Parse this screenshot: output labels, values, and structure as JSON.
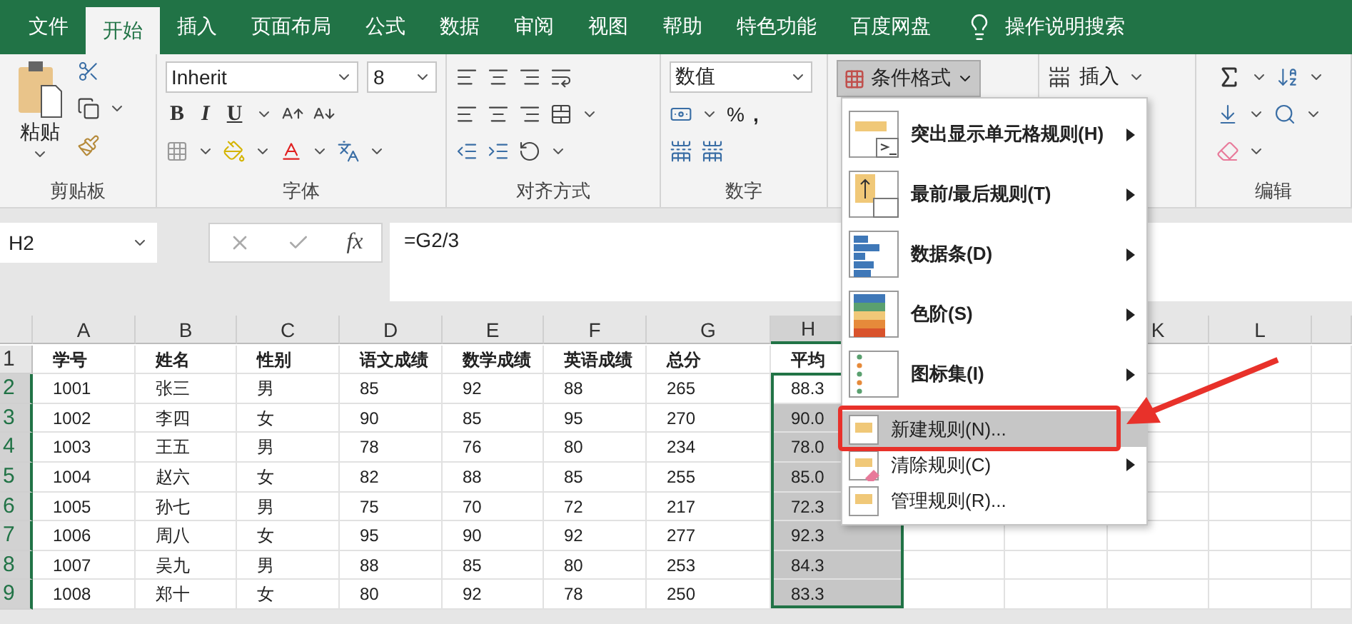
{
  "tabs": [
    {
      "label": "文件",
      "selected": false
    },
    {
      "label": "开始",
      "selected": true
    },
    {
      "label": "插入",
      "selected": false
    },
    {
      "label": "页面布局",
      "selected": false
    },
    {
      "label": "公式",
      "selected": false
    },
    {
      "label": "数据",
      "selected": false
    },
    {
      "label": "审阅",
      "selected": false
    },
    {
      "label": "视图",
      "selected": false
    },
    {
      "label": "帮助",
      "selected": false
    },
    {
      "label": "特色功能",
      "selected": false
    },
    {
      "label": "百度网盘",
      "selected": false
    }
  ],
  "tell_me": "操作说明搜索",
  "ribbon": {
    "clipboard": {
      "paste": "粘贴",
      "label": "剪贴板"
    },
    "font": {
      "name": "Inherit",
      "size": "8",
      "bold": "B",
      "italic": "I",
      "underline": "U",
      "label": "字体"
    },
    "alignment": {
      "label": "对齐方式"
    },
    "number": {
      "format": "数值",
      "percent": "%",
      "comma": ",",
      "label": "数字"
    },
    "styles": {
      "conditional_formatting": "条件格式",
      "pressed": true
    },
    "cells": {
      "insert": "插入"
    },
    "editing": {
      "label": "编辑"
    }
  },
  "name_box": "H2",
  "function_label": "fx",
  "formula": "=G2/3",
  "columns": [
    "A",
    "B",
    "C",
    "D",
    "E",
    "F",
    "G",
    "H",
    "K",
    "L"
  ],
  "rows": [
    {
      "number": "1",
      "selected": false,
      "cells": [
        "学号",
        "姓名",
        "性别",
        "语文成绩",
        "数学成绩",
        "英语成绩",
        "总分",
        "平均"
      ]
    },
    {
      "number": "2",
      "selected": true,
      "cells": [
        "1001",
        "张三",
        "男",
        "85",
        "92",
        "88",
        "265",
        "88.3"
      ]
    },
    {
      "number": "3",
      "selected": true,
      "cells": [
        "1002",
        "李四",
        "女",
        "90",
        "85",
        "95",
        "270",
        "90.0"
      ]
    },
    {
      "number": "4",
      "selected": true,
      "cells": [
        "1003",
        "王五",
        "男",
        "78",
        "76",
        "80",
        "234",
        "78.0"
      ]
    },
    {
      "number": "5",
      "selected": true,
      "cells": [
        "1004",
        "赵六",
        "女",
        "82",
        "88",
        "85",
        "255",
        "85.0"
      ]
    },
    {
      "number": "6",
      "selected": true,
      "cells": [
        "1005",
        "孙七",
        "男",
        "75",
        "70",
        "72",
        "217",
        "72.3"
      ]
    },
    {
      "number": "7",
      "selected": true,
      "cells": [
        "1006",
        "周八",
        "女",
        "95",
        "90",
        "92",
        "277",
        "92.3"
      ]
    },
    {
      "number": "8",
      "selected": true,
      "cells": [
        "1007",
        "吴九",
        "男",
        "88",
        "85",
        "80",
        "253",
        "84.3"
      ]
    },
    {
      "number": "9",
      "selected": true,
      "cells": [
        "1008",
        "郑十",
        "女",
        "80",
        "92",
        "78",
        "250",
        "83.3"
      ]
    }
  ],
  "menu": [
    {
      "label": "突出显示单元格规则(H)",
      "kind": "highlight",
      "submenu": true,
      "highlighted": false
    },
    {
      "label": "最前/最后规则(T)",
      "kind": "topbottom",
      "submenu": true,
      "highlighted": false
    },
    {
      "label": "数据条(D)",
      "kind": "databars",
      "submenu": true,
      "highlighted": false
    },
    {
      "label": "色阶(S)",
      "kind": "colorscale",
      "submenu": true,
      "highlighted": false
    },
    {
      "label": "图标集(I)",
      "kind": "iconsets",
      "submenu": true,
      "highlighted": false
    },
    {
      "label": "新建规则(N)...",
      "kind": "newrule",
      "submenu": false,
      "highlighted": true
    },
    {
      "label": "清除规则(C)",
      "kind": "clear",
      "submenu": true,
      "highlighted": false
    },
    {
      "label": "管理规则(R)...",
      "kind": "manage",
      "submenu": false,
      "highlighted": false
    }
  ],
  "annotation": {
    "kind": "box-and-arrow"
  }
}
